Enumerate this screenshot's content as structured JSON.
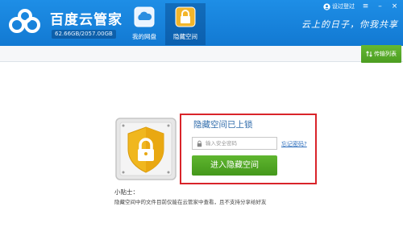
{
  "app": {
    "title": "百度云管家",
    "quota": "62.66GB/2057.00GB",
    "slogan": "云上的日子，你我共享"
  },
  "tabs": [
    {
      "label": "我的网盘",
      "icon": "cloud-drive-icon",
      "active": false
    },
    {
      "label": "隐藏空间",
      "icon": "lock-icon",
      "active": true
    }
  ],
  "window_controls": {
    "login_label": "设过登过",
    "menu_icon": "menu-icon",
    "minimize_icon": "minimize-icon",
    "close_icon": "close-icon"
  },
  "toolbar": {
    "transfer_label": "传输列表"
  },
  "hidden_space": {
    "title": "隐藏空间已上锁",
    "password_placeholder": "输入安全密码",
    "forgot_label": "忘记密码?",
    "enter_label": "进入隐藏空间",
    "tips_heading": "小贴士：",
    "tips_text": "隐藏空间中的文件目前仅能在云管家中查看，且不支持分享给好友"
  },
  "colors": {
    "header_blue": "#1784dc",
    "accent_green": "#52a825",
    "highlight_red": "#d9242a",
    "shield_gold": "#f0b71f"
  }
}
